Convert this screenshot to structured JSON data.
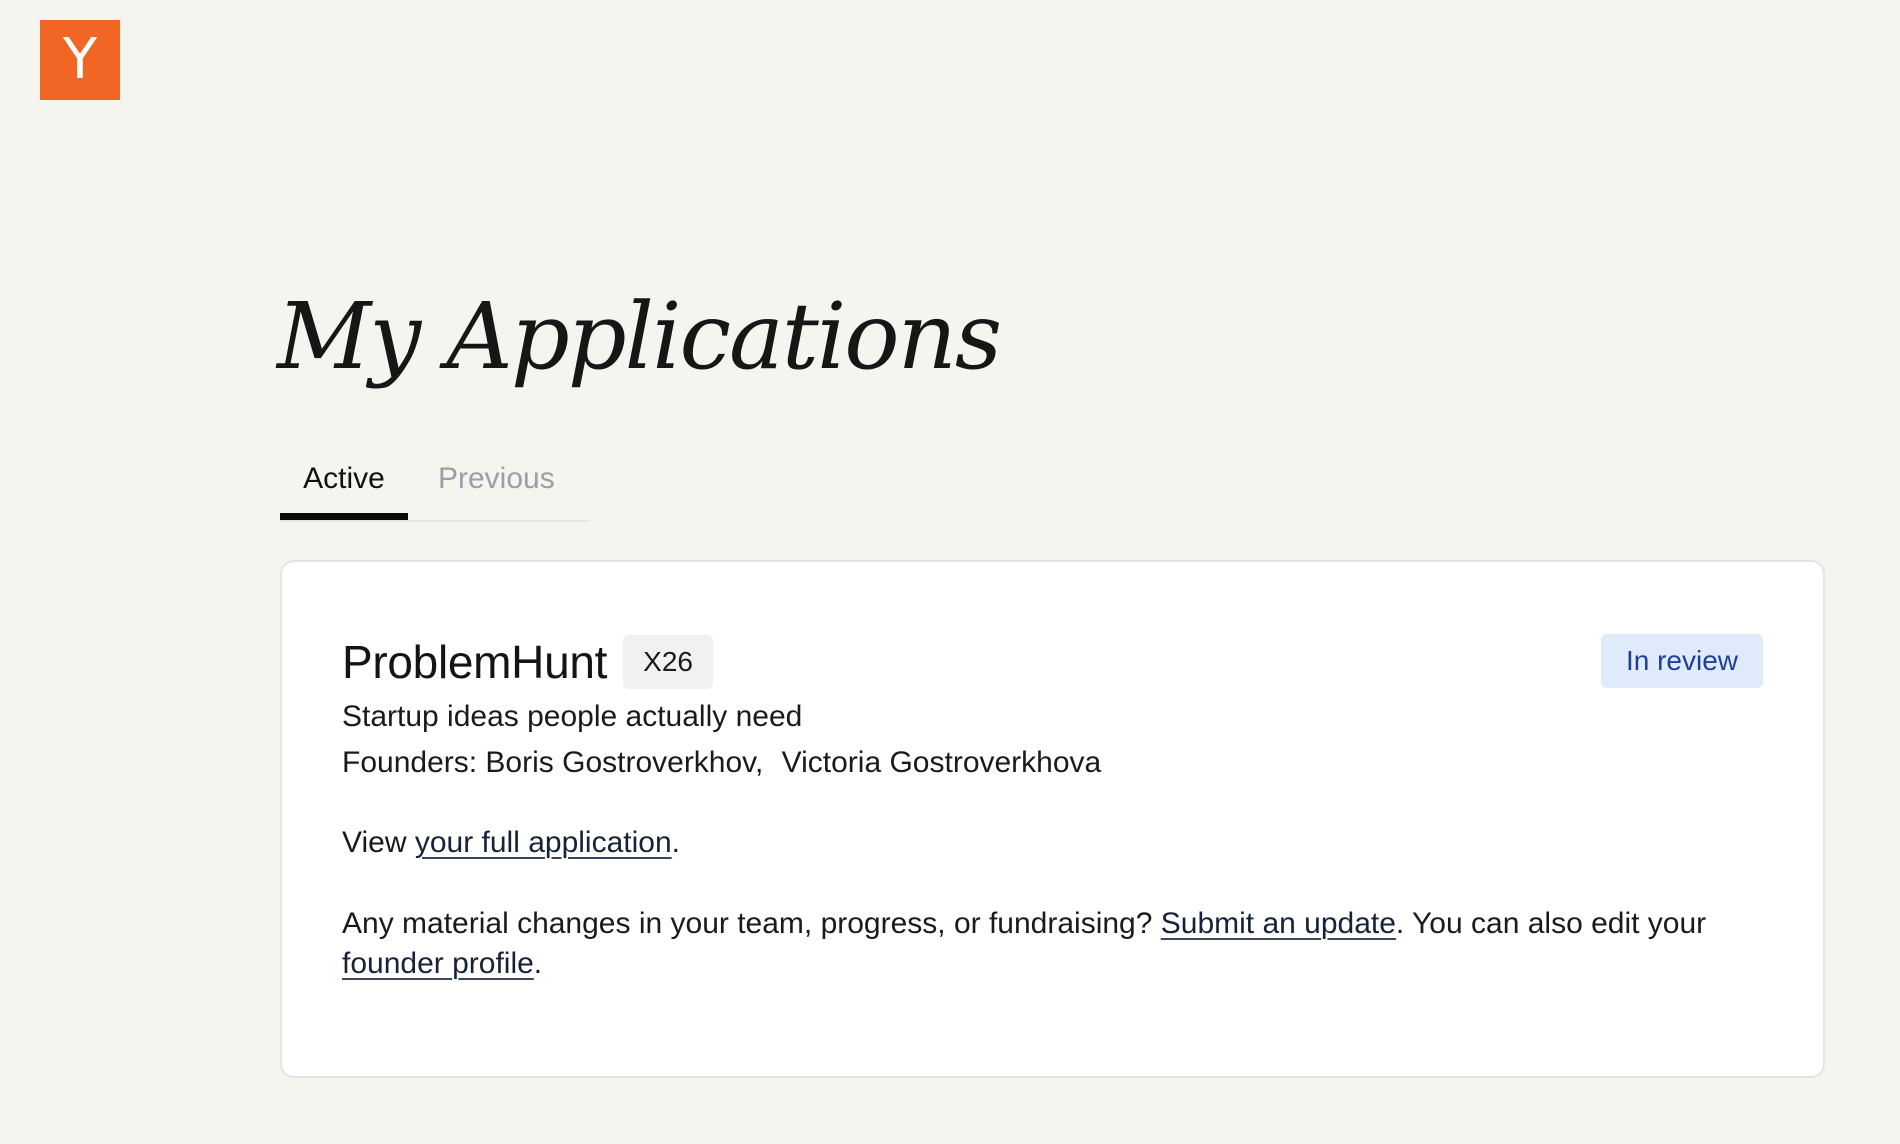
{
  "brand": {
    "logo_letter": "Y",
    "logo_color": "#f26625"
  },
  "page": {
    "title": "My Applications"
  },
  "tabs": [
    {
      "label": "Active",
      "selected": true
    },
    {
      "label": "Previous",
      "selected": false
    }
  ],
  "application": {
    "company_name": "ProblemHunt",
    "batch": "X26",
    "status": "In review",
    "status_bg_color": "#dfeafb",
    "status_text_color": "#1f3f96",
    "tagline": "Startup ideas people actually need",
    "founders_label": "Founders:",
    "founders": [
      "Boris Gostroverkhov",
      "Victoria Gostroverkhova"
    ],
    "founders_separator": ",",
    "view_prefix": "View ",
    "view_link": "your full application",
    "view_suffix": ".",
    "changes_prefix": "Any material changes in your team, progress, or fundraising? ",
    "update_link": "Submit an update",
    "changes_middle": ". You can also edit your ",
    "profile_link": "founder profile",
    "changes_suffix": "."
  },
  "colors": {
    "background": "#f5f4ee",
    "card_background": "#ffffff",
    "active_tab_indicator": "#0b0b0b",
    "inactive_tab_text": "#9aa0a8"
  }
}
